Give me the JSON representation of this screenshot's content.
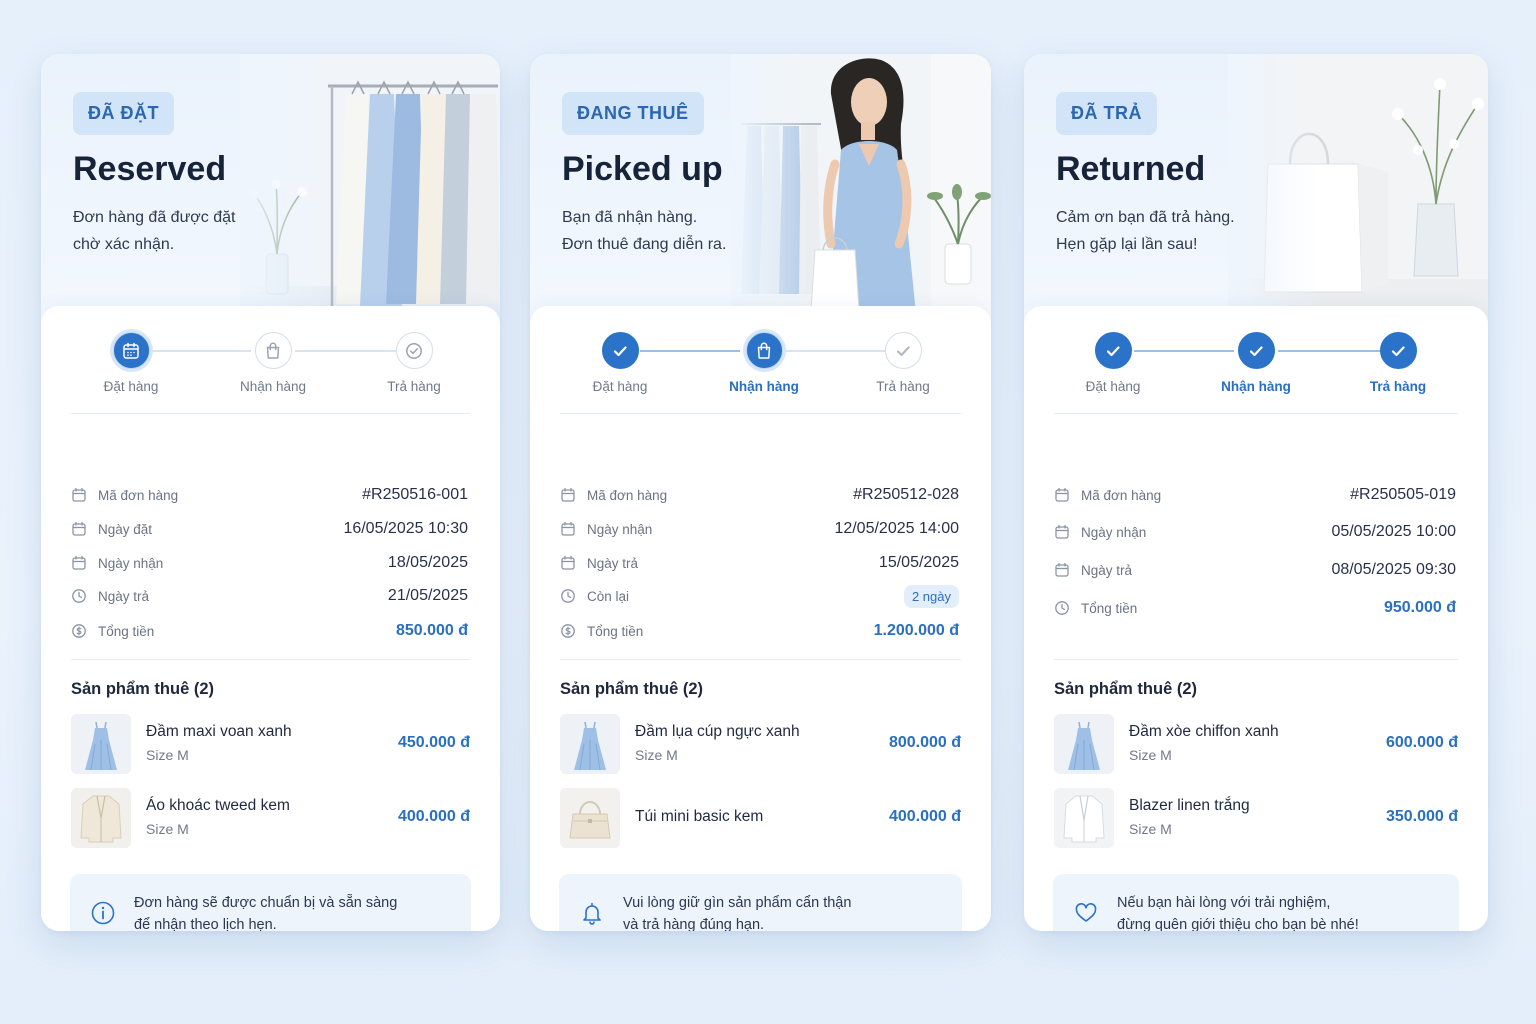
{
  "cards": [
    {
      "badge": "ĐÃ ĐẶT",
      "title": "Reserved",
      "desc": [
        "Đơn hàng đã được đặt",
        "chờ xác nhận."
      ],
      "steps": [
        "Đặt hàng",
        "Nhận hàng",
        "Trả hàng"
      ],
      "info": [
        {
          "label": "Mã đơn hàng",
          "value": "#R250516-001"
        },
        {
          "label": "Ngày đặt",
          "value": "16/05/2025 10:30"
        },
        {
          "label": "Ngày nhận",
          "value": "18/05/2025"
        },
        {
          "label": "Ngày trả",
          "value": "21/05/2025"
        },
        {
          "label": "Tổng tiền",
          "value": "850.000 đ"
        }
      ],
      "products_title": "Sản phẩm thuê (2)",
      "products": [
        {
          "name": "Đầm maxi voan xanh",
          "size": "Size M",
          "price": "450.000 đ"
        },
        {
          "name": "Áo khoác tweed kem",
          "size": "Size M",
          "price": "400.000 đ"
        }
      ],
      "note": [
        "Đơn hàng sẽ được chuẩn bị và sẵn sàng",
        "để nhận theo lịch hẹn."
      ]
    },
    {
      "badge": "ĐANG THUÊ",
      "title": "Picked up",
      "desc": [
        "Bạn đã nhận hàng.",
        "Đơn thuê đang diễn ra."
      ],
      "steps": [
        "Đặt hàng",
        "Nhận hàng",
        "Trả hàng"
      ],
      "info": [
        {
          "label": "Mã đơn hàng",
          "value": "#R250512-028"
        },
        {
          "label": "Ngày nhận",
          "value": "12/05/2025 14:00"
        },
        {
          "label": "Ngày trả",
          "value": "15/05/2025"
        },
        {
          "label": "Còn lại",
          "value": "2 ngày"
        },
        {
          "label": "Tổng tiền",
          "value": "1.200.000 đ"
        }
      ],
      "products_title": "Sản phẩm thuê (2)",
      "products": [
        {
          "name": "Đầm lụa cúp ngực xanh",
          "size": "Size M",
          "price": "800.000 đ"
        },
        {
          "name": "Túi mini basic kem",
          "size": "",
          "price": "400.000 đ"
        }
      ],
      "note": [
        "Vui lòng giữ gìn sản phẩm cẩn thận",
        "và trả hàng đúng hạn."
      ]
    },
    {
      "badge": "ĐÃ TRẢ",
      "title": "Returned",
      "desc": [
        "Cảm ơn bạn đã trả hàng.",
        "Hẹn gặp lại lần sau!"
      ],
      "steps": [
        "Đặt hàng",
        "Nhận hàng",
        "Trả hàng"
      ],
      "info": [
        {
          "label": "Mã đơn hàng",
          "value": "#R250505-019"
        },
        {
          "label": "Ngày nhận",
          "value": "05/05/2025 10:00"
        },
        {
          "label": "Ngày trả",
          "value": "08/05/2025 09:30"
        },
        {
          "label": "Tổng tiền",
          "value": "950.000 đ"
        }
      ],
      "products_title": "Sản phẩm thuê (2)",
      "products": [
        {
          "name": "Đầm xòe chiffon xanh",
          "size": "Size M",
          "price": "600.000 đ"
        },
        {
          "name": "Blazer linen trắng",
          "size": "Size M",
          "price": "350.000 đ"
        }
      ],
      "note": [
        "Nếu bạn hài lòng với trải nghiệm,",
        "đừng quên giới thiệu cho bạn bè nhé!"
      ]
    }
  ],
  "icons": {
    "step": [
      "calendar-icon",
      "bag-icon",
      "check-circle-icon"
    ],
    "notes": [
      "info-icon",
      "bell-icon",
      "heart-icon"
    ]
  },
  "colors": {
    "accent": "#2b73c9",
    "price": "#2a6fc0",
    "badge_bg": "#d2e4f8",
    "note_bg": "#edf4fc",
    "page_bg": "#e6f0fb"
  }
}
